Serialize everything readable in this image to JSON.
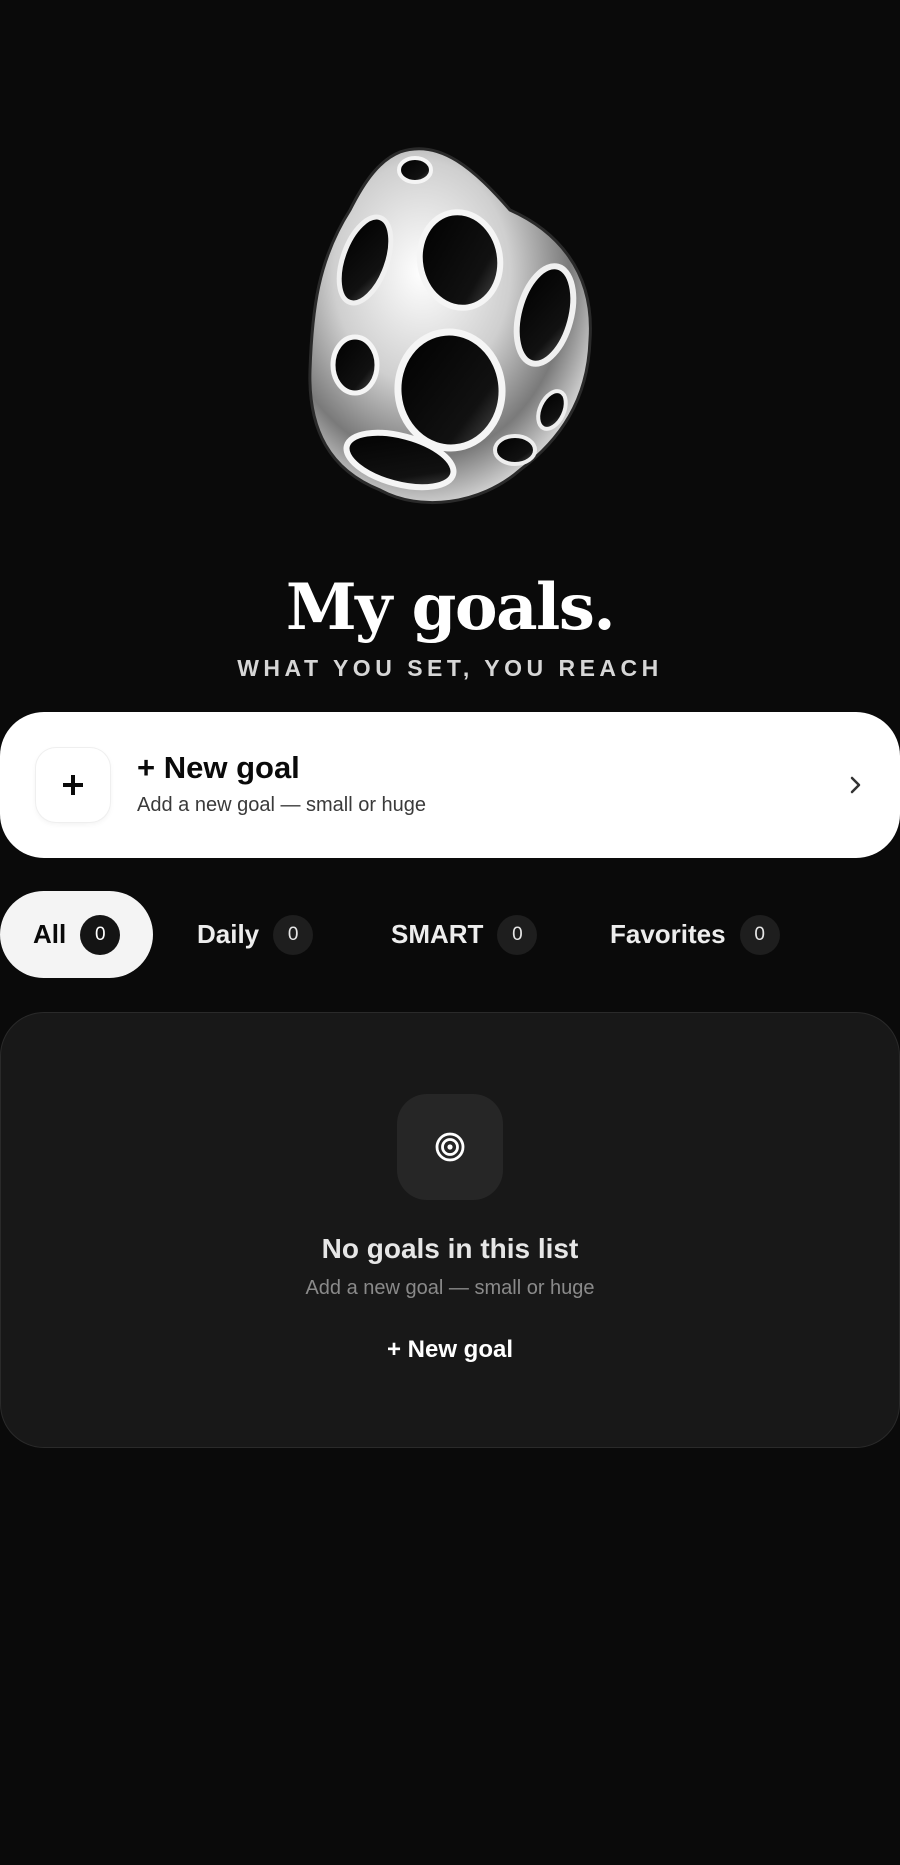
{
  "hero": {
    "title": "My goals.",
    "subtitle": "WHAT YOU SET, YOU REACH",
    "image_icon": "sculpture-illustration"
  },
  "new_goal_card": {
    "title": "+ New goal",
    "subtitle": "Add a new goal — small or huge",
    "icon": "plus-icon",
    "chevron_icon": "chevron-right-icon"
  },
  "tabs": [
    {
      "label": "All",
      "count": "0",
      "active": true
    },
    {
      "label": "Daily",
      "count": "0",
      "active": false
    },
    {
      "label": "SMART",
      "count": "0",
      "active": false
    },
    {
      "label": "Favorites",
      "count": "0",
      "active": false
    }
  ],
  "empty_state": {
    "icon": "target-icon",
    "title": "No goals in this list",
    "subtitle": "Add a new goal — small or huge",
    "action_label": "+ New goal"
  },
  "colors": {
    "background": "#0a0a0a",
    "card": "#ffffff",
    "panel": "#181818",
    "active_tab": "#f4f4f4"
  }
}
